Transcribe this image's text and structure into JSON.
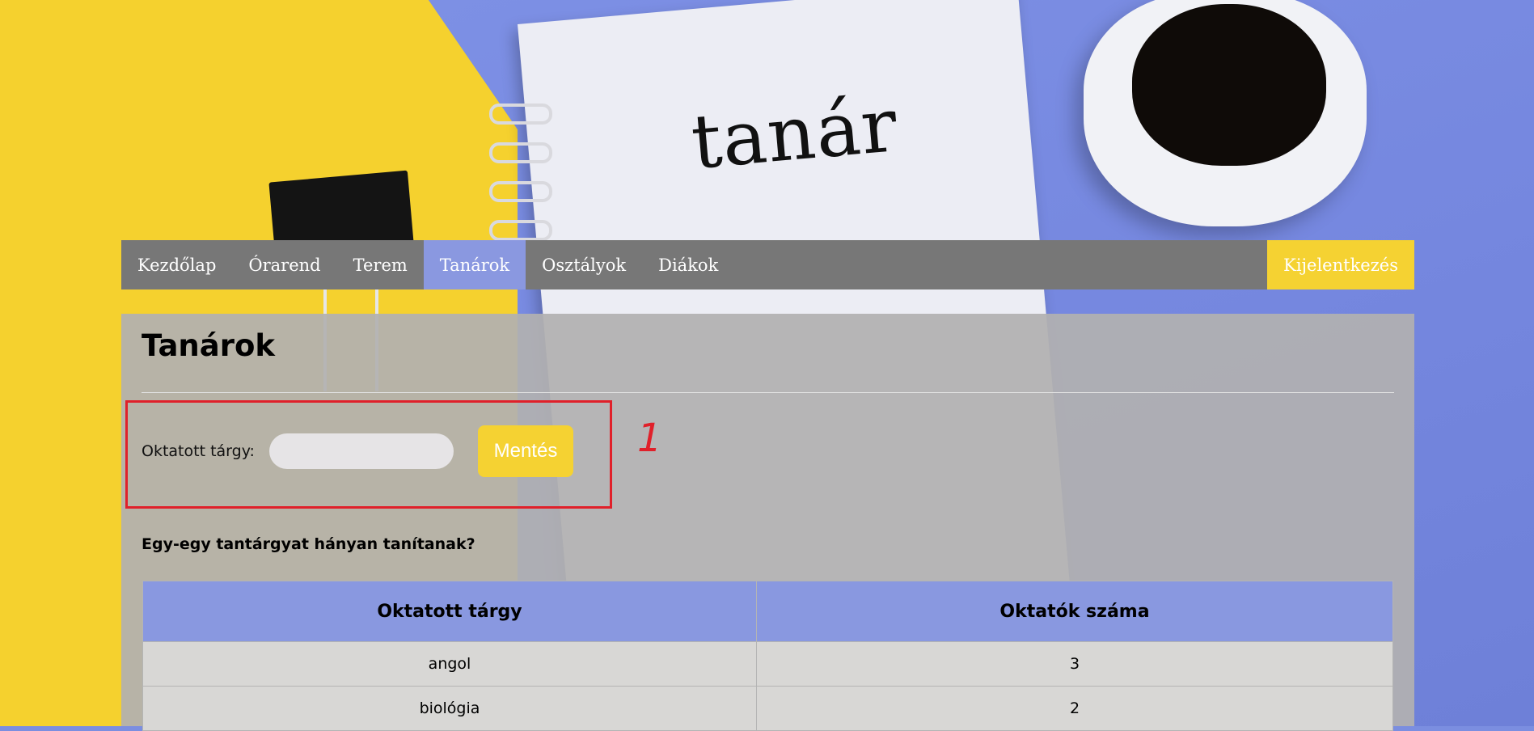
{
  "nav": {
    "items": [
      {
        "label": "Kezdőlap",
        "active": false
      },
      {
        "label": "Órarend",
        "active": false
      },
      {
        "label": "Terem",
        "active": false
      },
      {
        "label": "Tanárok",
        "active": true
      },
      {
        "label": "Osztályok",
        "active": false
      },
      {
        "label": "Diákok",
        "active": false
      }
    ],
    "logout_label": "Kijelentkezés"
  },
  "hero": {
    "notebook_word": "tanár"
  },
  "page": {
    "title": "Tanárok",
    "form": {
      "label": "Oktatott tárgy:",
      "input_value": "",
      "save_label": "Mentés"
    },
    "annotation_number": "1",
    "question": "Egy-egy tantárgyat hányan tanítanak?",
    "table": {
      "headers": [
        "Oktatott tárgy",
        "Oktatók száma"
      ],
      "rows": [
        [
          "angol",
          "3"
        ],
        [
          "biológia",
          "2"
        ]
      ]
    }
  },
  "colors": {
    "accent_yellow": "#f5d232",
    "accent_blue": "#8a98e0",
    "nav_bg": "#777777",
    "annotation_red": "#e0202a"
  }
}
